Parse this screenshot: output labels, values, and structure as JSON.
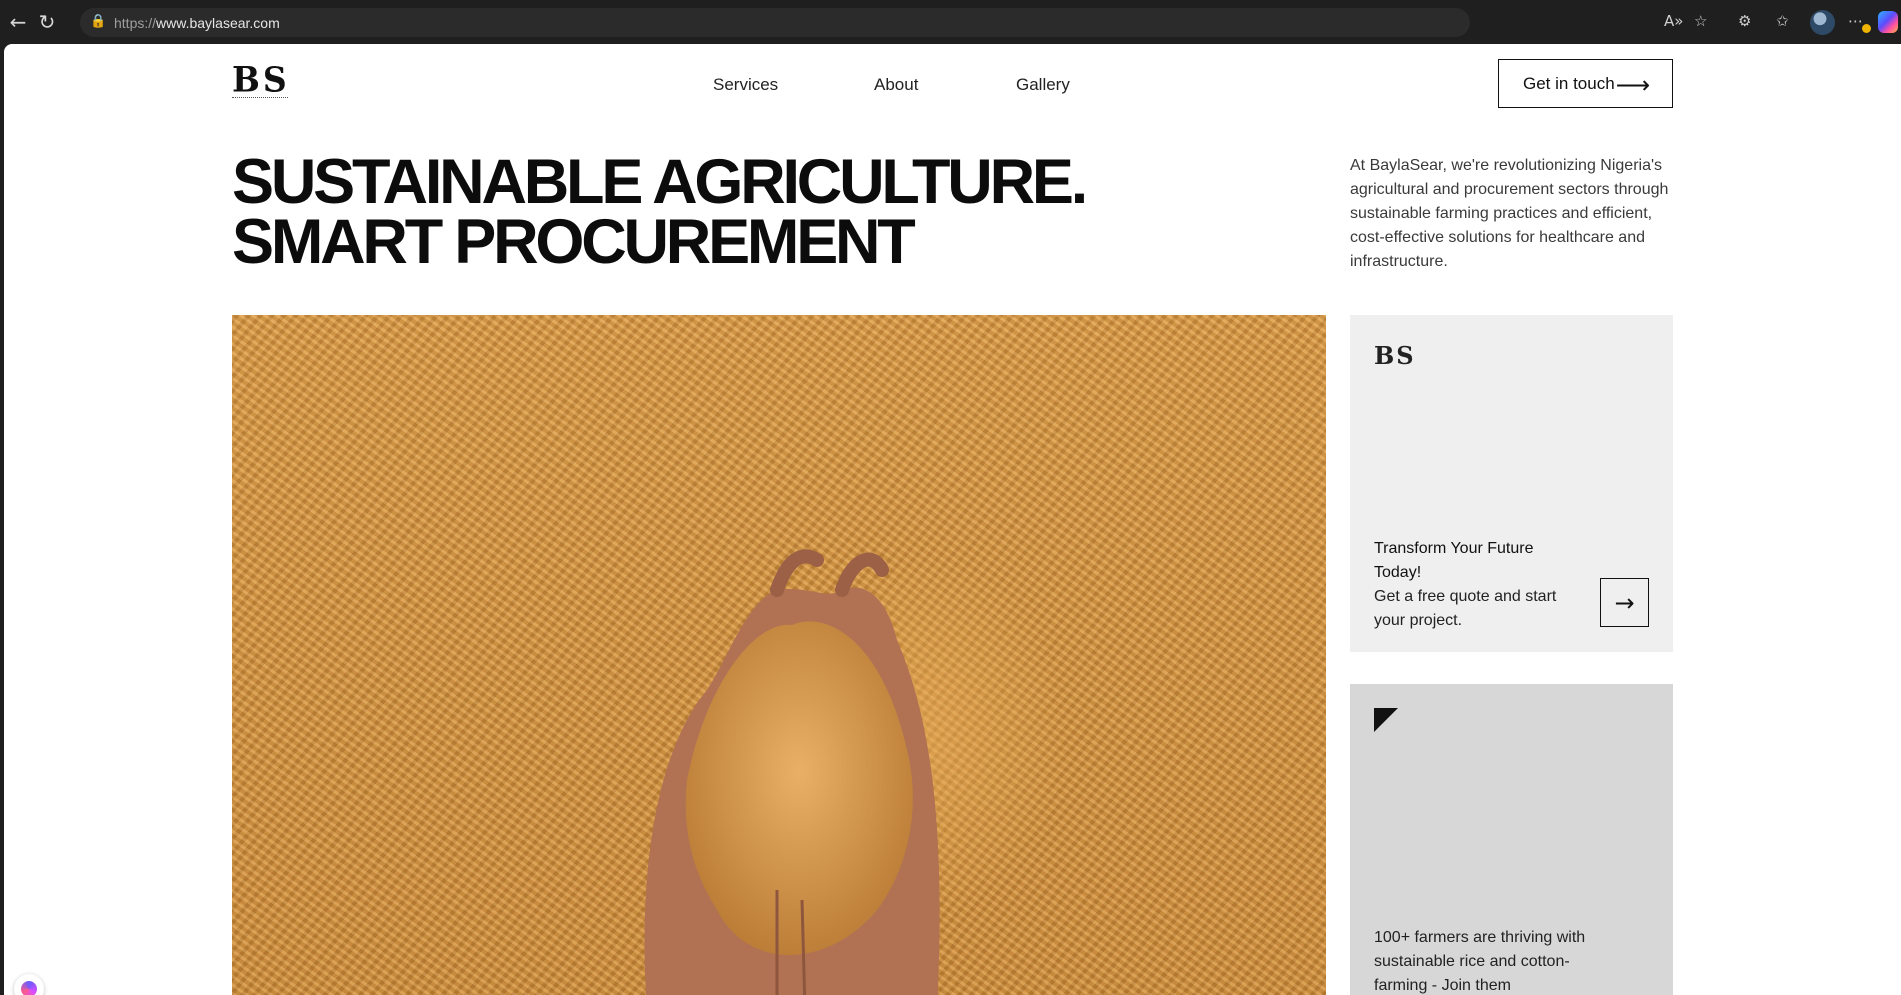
{
  "browser": {
    "url_scheme": "https://",
    "url_host": "www.baylasear.com",
    "icons": [
      "back-icon",
      "reload-icon",
      "lock-icon",
      "read-aloud-icon",
      "favorite-icon",
      "extensions-icon",
      "favorites-icon",
      "profile-avatar",
      "more-icon",
      "copilot-icon"
    ]
  },
  "header": {
    "logo_text": "BS",
    "nav": [
      "Services",
      "About",
      "Gallery"
    ],
    "cta_label": "Get in touch"
  },
  "hero": {
    "title_line1": "SUSTAINABLE AGRICULTURE.",
    "title_line2": "SMART PROCUREMENT",
    "intro": "At BaylaSear, we're revolutionizing Nigeria's agricultural and procurement sectors through sustainable farming practices and efficient, cost-effective solutions for healthcare and infrastructure."
  },
  "card_quote": {
    "logo_text": "BS",
    "title": "Transform Your Future Today!",
    "subtitle": "Get a free quote and start your project."
  },
  "card_farmers": {
    "text": "100+ farmers are thriving with sustainable rice and cotton-farming - Join them"
  },
  "colors": {
    "text_primary": "#0c0c0c",
    "card_light": "#efefef",
    "card_grey": "#d7d7d7",
    "grain": "#d69a4a"
  }
}
